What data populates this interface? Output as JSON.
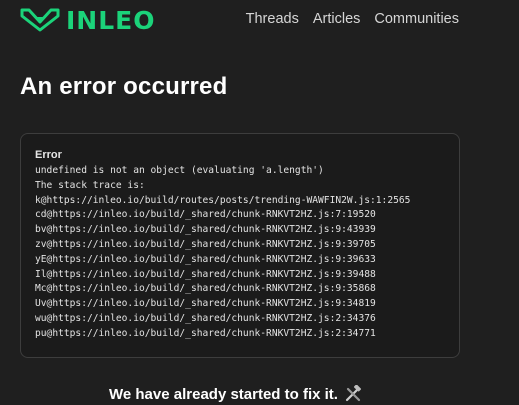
{
  "header": {
    "logo_text": "INLEO",
    "nav": [
      "Threads",
      "Articles",
      "Communities"
    ]
  },
  "page": {
    "title": "An error occurred"
  },
  "error": {
    "heading": "Error",
    "lines": [
      "undefined is not an object (evaluating 'a.length')",
      "The stack trace is:",
      "k@https://inleo.io/build/routes/posts/trending-WAWFIN2W.js:1:2565",
      "cd@https://inleo.io/build/_shared/chunk-RNKVT2HZ.js:7:19520",
      "bv@https://inleo.io/build/_shared/chunk-RNKVT2HZ.js:9:43939",
      "zv@https://inleo.io/build/_shared/chunk-RNKVT2HZ.js:9:39705",
      "yE@https://inleo.io/build/_shared/chunk-RNKVT2HZ.js:9:39633",
      "Il@https://inleo.io/build/_shared/chunk-RNKVT2HZ.js:9:39488",
      "Mc@https://inleo.io/build/_shared/chunk-RNKVT2HZ.js:9:35868",
      "Uv@https://inleo.io/build/_shared/chunk-RNKVT2HZ.js:9:34819",
      "wu@https://inleo.io/build/_shared/chunk-RNKVT2HZ.js:2:34376",
      "pu@https://inleo.io/build/_shared/chunk-RNKVT2HZ.js:2:34771"
    ]
  },
  "footer": {
    "message": "We have already started to fix it.",
    "icon": "tools-icon"
  },
  "colors": {
    "background": "#1f1f1f",
    "brand": "#1bd37a",
    "box_border": "#3d3d3d"
  }
}
